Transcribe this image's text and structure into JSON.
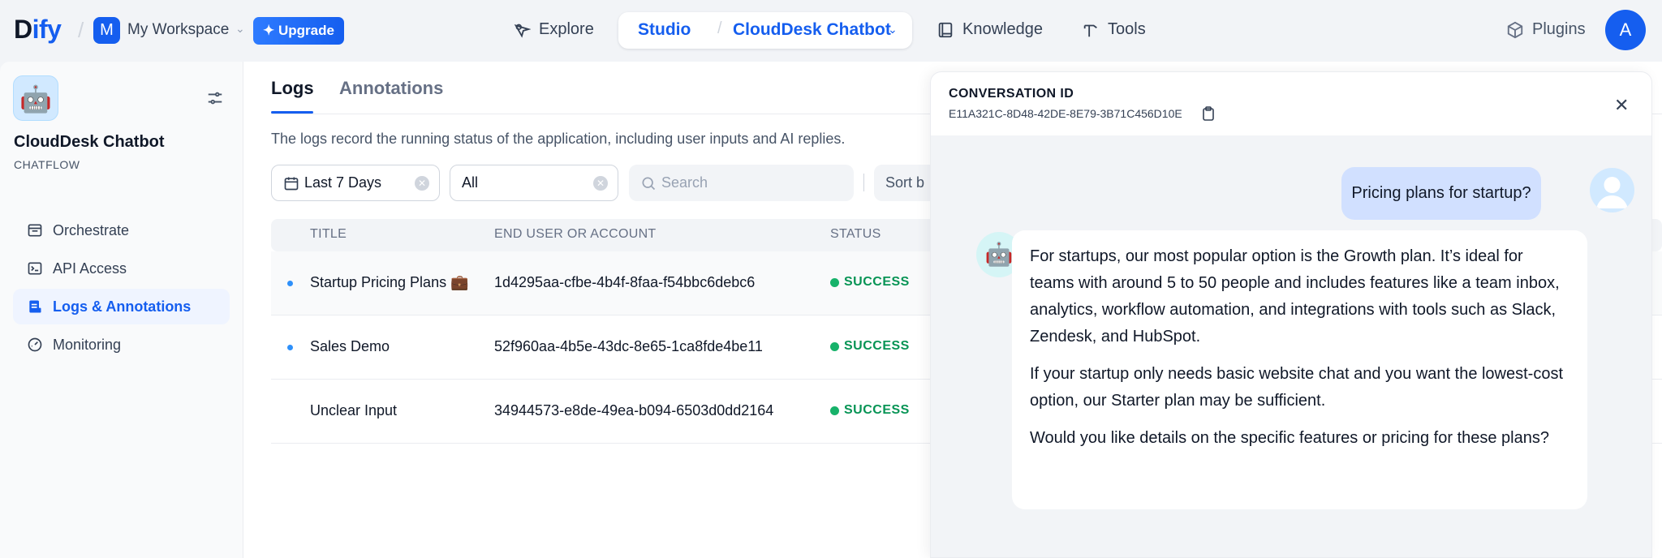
{
  "header": {
    "logo_part1": "D",
    "logo_part2": "ify",
    "workspace_badge": "M",
    "workspace_name": "My Workspace",
    "upgrade_label": "Upgrade",
    "nav": {
      "explore": "Explore",
      "studio": "Studio",
      "app_name": "CloudDesk Chatbot",
      "knowledge": "Knowledge",
      "tools": "Tools",
      "plugins": "Plugins"
    },
    "user_initial": "A"
  },
  "sidebar": {
    "app_name": "CloudDesk Chatbot",
    "app_type": "CHATFLOW",
    "items": [
      {
        "label": "Orchestrate",
        "icon": "window-icon"
      },
      {
        "label": "API Access",
        "icon": "terminal-icon"
      },
      {
        "label": "Logs & Annotations",
        "icon": "file-list-icon"
      },
      {
        "label": "Monitoring",
        "icon": "dashboard-icon"
      }
    ]
  },
  "main": {
    "tabs": [
      "Logs",
      "Annotations"
    ],
    "description": "The logs record the running status of the application, including user inputs and AI replies.",
    "filters": {
      "period": "Last 7 Days",
      "status": "All",
      "search_placeholder": "Search",
      "sort": "Sort b"
    },
    "columns": [
      "TITLE",
      "END USER OR ACCOUNT",
      "STATUS"
    ],
    "rows": [
      {
        "title": "Startup Pricing Plans 💼",
        "user": "1d4295aa-cfbe-4b4f-8faa-f54bbc6debc6",
        "status": "SUCCESS",
        "unread": true
      },
      {
        "title": "Sales Demo",
        "user": "52f960aa-4b5e-43dc-8e65-1ca8fde4be11",
        "status": "SUCCESS",
        "unread": true
      },
      {
        "title": "Unclear Input",
        "user": "34944573-e8de-49ea-b094-6503d0dd2164",
        "status": "SUCCESS",
        "unread": false
      }
    ]
  },
  "drawer": {
    "label": "CONVERSATION ID",
    "conversation_id": "E11A321C-8D48-42DE-8E79-3B71C456D10E",
    "user_message": "Pricing plans for startup?",
    "bot_paragraphs": [
      "For startups, our most popular option is the Growth plan. It’s ideal for teams with around 5 to 50 people and includes features like a team inbox, analytics, workflow automation, and integrations with tools such as Slack, Zendesk, and HubSpot.",
      "If your startup only needs basic website chat and you want the lowest-cost option, our Starter plan may be sufficient.",
      "Would you like details on the specific features or pricing for these plans?"
    ]
  },
  "colors": {
    "accent": "#155eef",
    "success": "#079455",
    "user_bubble": "#d1e0ff"
  }
}
